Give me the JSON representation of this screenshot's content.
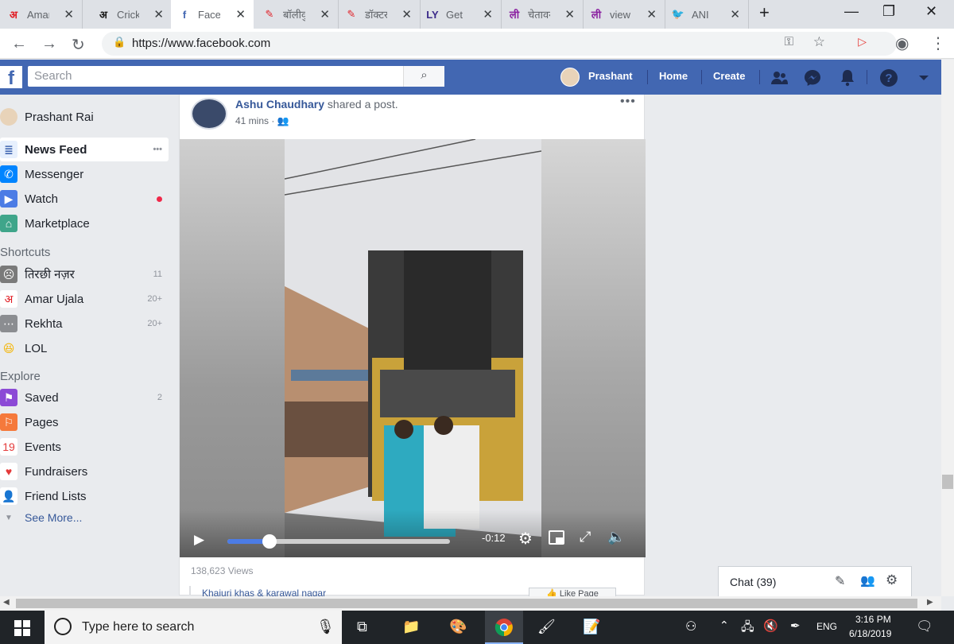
{
  "browser": {
    "tabs": [
      {
        "title": "Amar Ujala",
        "favicon": "अ",
        "favicon_color": "#e11b22",
        "active": false
      },
      {
        "title": "Cricket",
        "favicon": "अ",
        "favicon_color": "#1a1a1a",
        "active": false
      },
      {
        "title": "Facebook",
        "favicon": "f",
        "favicon_color": "#4267b2",
        "active": true
      },
      {
        "title": "बॉलीवुड",
        "favicon": "✎",
        "favicon_color": "#e11b22",
        "active": false
      },
      {
        "title": "डॉक्टर",
        "favicon": "✎",
        "favicon_color": "#e11b22",
        "active": false
      },
      {
        "title": "Get",
        "favicon": "LY",
        "favicon_color": "#3b2a8a",
        "active": false
      },
      {
        "title": "चेतावनी",
        "favicon": "ली",
        "favicon_color": "#8a1fa0",
        "active": false
      },
      {
        "title": "view",
        "favicon": "ली",
        "favicon_color": "#8a1fa0",
        "active": false
      },
      {
        "title": "ANI",
        "favicon": "🐦",
        "favicon_color": "#1da1f2",
        "active": false
      }
    ],
    "new_tab": "+",
    "url": "https://www.facebook.com"
  },
  "fb_header": {
    "search_placeholder": "Search",
    "profile_name": "Prashant",
    "home": "Home",
    "create": "Create"
  },
  "sidebar": {
    "profile": "Prashant Rai",
    "main": [
      {
        "label": "News Feed",
        "icon": "news-feed-icon",
        "extra": "•••"
      },
      {
        "label": "Messenger",
        "icon": "messenger-icon",
        "extra": ""
      },
      {
        "label": "Watch",
        "icon": "watch-icon",
        "extra": ""
      },
      {
        "label": "Marketplace",
        "icon": "marketplace-icon",
        "extra": ""
      }
    ],
    "shortcuts_heading": "Shortcuts",
    "shortcuts": [
      {
        "label": "तिरछी नज़र",
        "count": "11"
      },
      {
        "label": "Amar Ujala",
        "count": "20+"
      },
      {
        "label": "Rekhta",
        "count": "20+"
      },
      {
        "label": "LOL",
        "count": ""
      }
    ],
    "explore_heading": "Explore",
    "explore": [
      {
        "label": "Saved",
        "count": "2"
      },
      {
        "label": "Pages",
        "count": ""
      },
      {
        "label": "Events",
        "count": ""
      },
      {
        "label": "Fundraisers",
        "count": ""
      },
      {
        "label": "Friend Lists",
        "count": ""
      }
    ],
    "see_more": "See More..."
  },
  "post": {
    "author": "Ashu Chaudhary",
    "action": "shared a post.",
    "time": "41 mins",
    "menu": "•••",
    "video": {
      "time_remaining": "-0:12",
      "progress_fraction": 0.19
    },
    "views": "138,623 Views",
    "shared_page": "Khajuri khas & karawal nagar",
    "like_page_button": "Like Page"
  },
  "chat": {
    "label": "Chat (39)"
  },
  "taskbar": {
    "search_placeholder": "Type here to search",
    "lang": "ENG",
    "time": "3:16 PM",
    "date": "6/18/2019"
  }
}
